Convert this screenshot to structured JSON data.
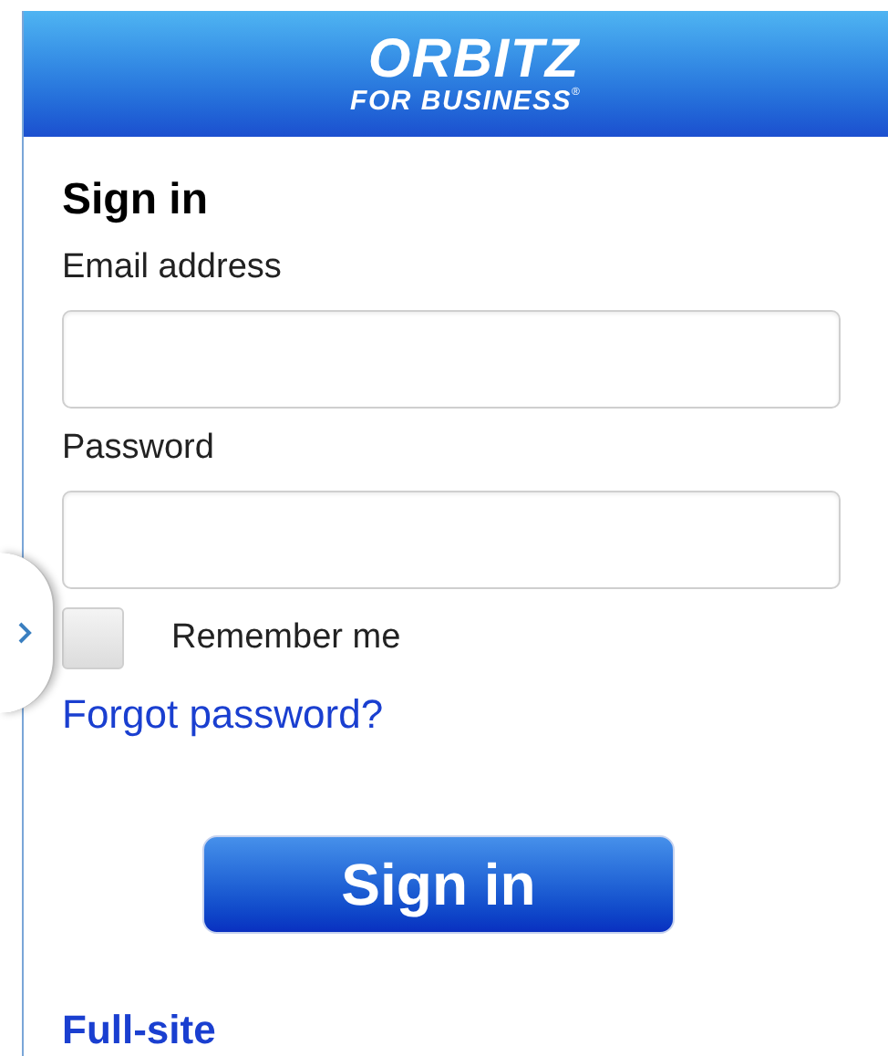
{
  "header": {
    "logo": "ORBITZ",
    "logo_subtitle": "FOR BUSINESS",
    "logo_mark": "®"
  },
  "form": {
    "title": "Sign in",
    "fields": [
      {
        "label": "Email address"
      },
      {
        "label": "Password"
      }
    ],
    "remember_me": {
      "label": "Remember me",
      "checked": false
    },
    "forgot_link": "Forgot password?",
    "submit": "Sign in"
  },
  "footer_link": "Full-site"
}
